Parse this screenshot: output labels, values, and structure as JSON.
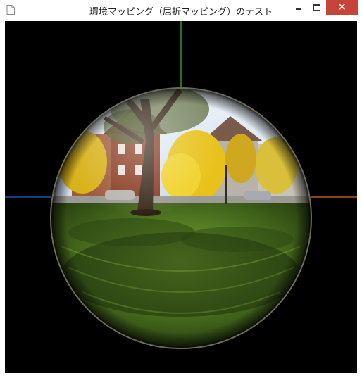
{
  "window": {
    "title": "環境マッピング（屈折マッピング）のテスト",
    "icons": {
      "app": "document-icon",
      "minimize": "minimize-icon",
      "maximize": "maximize-icon",
      "close": "close-icon"
    },
    "close_symbol": "✕"
  },
  "scene": {
    "background_color": "#000000",
    "axes": {
      "x_positive_color": "#b85c1e",
      "x_negative_color": "#1e4fa8",
      "y_positive_color": "#3f8f2a"
    },
    "sphere": {
      "material": "refraction",
      "environment": "park-with-trees-and-houses"
    },
    "palette": {
      "sky": "#d7e6f2",
      "grass_light": "#6f9a2c",
      "grass_dark": "#22360e",
      "trees_yellow": "#e8c21b",
      "brick": "#8a3a22",
      "trunk": "#3b2b1c"
    }
  }
}
